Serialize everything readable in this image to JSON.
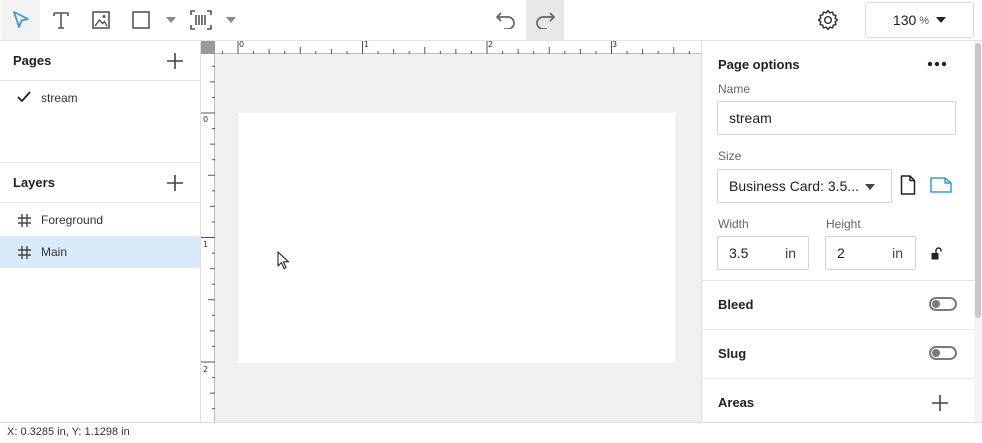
{
  "toolbar": {
    "tools": [
      {
        "name": "select-tool",
        "icon": "pointer-arrow-icon",
        "active": true
      },
      {
        "name": "text-tool",
        "icon": "text-icon"
      },
      {
        "name": "image-tool",
        "icon": "image-icon"
      },
      {
        "name": "shape-tool",
        "icon": "rectangle-icon"
      },
      {
        "name": "barcode-tool",
        "icon": "barcode-icon"
      }
    ],
    "undo_icon": "undo-icon",
    "redo_icon": "redo-icon",
    "settings_icon": "gear-icon",
    "zoom": {
      "value": "130",
      "unit": "%"
    }
  },
  "pages_panel": {
    "title": "Pages",
    "items": [
      {
        "label": "stream",
        "checked": true
      }
    ]
  },
  "layers_panel": {
    "title": "Layers",
    "items": [
      {
        "label": "Foreground",
        "selected": false
      },
      {
        "label": "Main",
        "selected": true
      }
    ]
  },
  "canvas": {
    "ruler_top_labels": [
      "0",
      "1",
      "2",
      "3"
    ],
    "ruler_left_labels": [
      "0",
      "1",
      "2"
    ]
  },
  "page_options": {
    "title": "Page options",
    "name_label": "Name",
    "name_value": "stream",
    "size_label": "Size",
    "size_value": "Business Card: 3.5...",
    "width_label": "Width",
    "width_value": "3.5",
    "width_unit": "in",
    "height_label": "Height",
    "height_value": "2",
    "height_unit": "in",
    "bleed_label": "Bleed",
    "bleed_on": false,
    "slug_label": "Slug",
    "slug_on": false,
    "areas_label": "Areas"
  },
  "colors": {
    "accent": "#3a9ad9",
    "selected_row": "#d9ebfa",
    "canvas_bg": "#f0f0f0"
  },
  "status": {
    "coords": "X: 0.3285 in, Y: 1.1298 in"
  }
}
